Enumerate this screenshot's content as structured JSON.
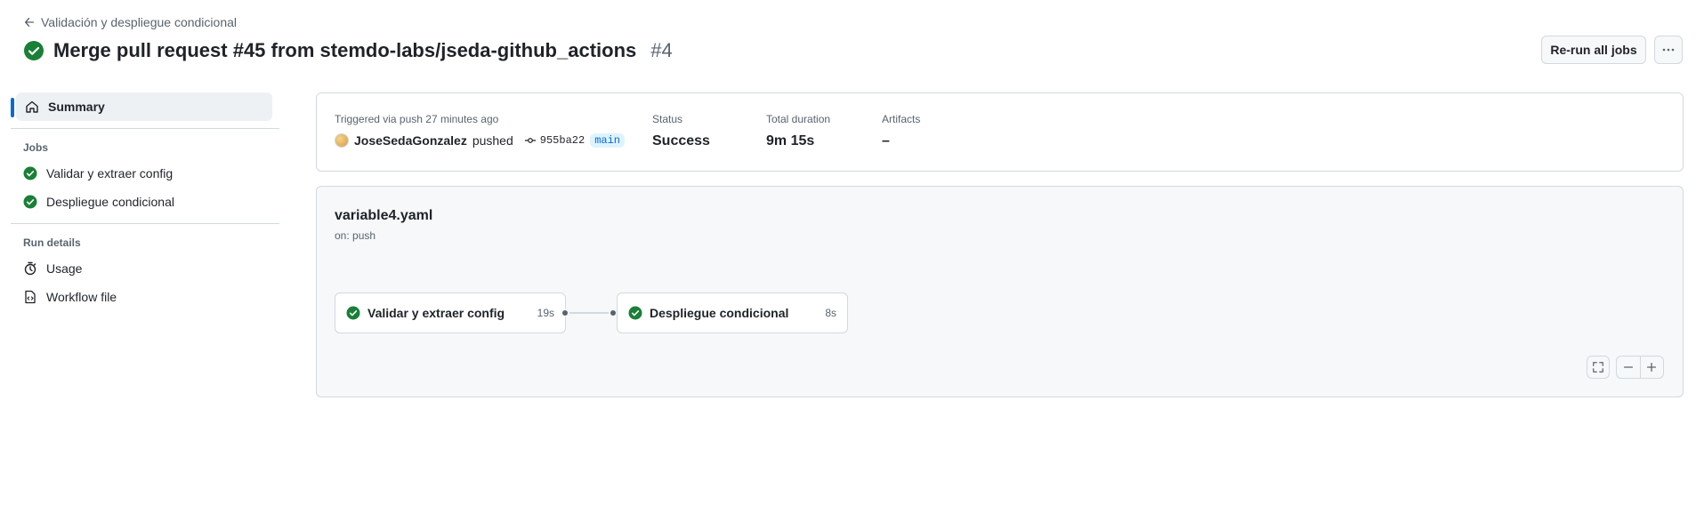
{
  "header": {
    "back_label": "Validación y despliegue condicional",
    "title": "Merge pull request #45 from stemdo-labs/jseda-github_actions",
    "run_number": "#4",
    "rerun_label": "Re-run all jobs",
    "more_icon": "kebab-horizontal-icon"
  },
  "sidebar": {
    "summary_label": "Summary",
    "jobs_heading": "Jobs",
    "jobs": [
      {
        "label": "Validar y extraer config",
        "status": "success"
      },
      {
        "label": "Despliegue condicional",
        "status": "success"
      }
    ],
    "run_details_heading": "Run details",
    "usage_label": "Usage",
    "workflow_file_label": "Workflow file"
  },
  "summary": {
    "trigger_label": "Triggered via push 27 minutes ago",
    "actor": "JoseSedaGonzalez",
    "action": "pushed",
    "commit": "955ba22",
    "branch": "main",
    "status_label": "Status",
    "status_value": "Success",
    "duration_label": "Total duration",
    "duration_value": "9m 15s",
    "artifacts_label": "Artifacts",
    "artifacts_value": "–"
  },
  "graph": {
    "workflow_file": "variable4.yaml",
    "trigger": "on: push",
    "jobs": [
      {
        "name": "Validar y extraer config",
        "duration": "19s"
      },
      {
        "name": "Despliegue condicional",
        "duration": "8s"
      }
    ]
  },
  "colors": {
    "success": "#1a7f37",
    "accent": "#0969da"
  }
}
